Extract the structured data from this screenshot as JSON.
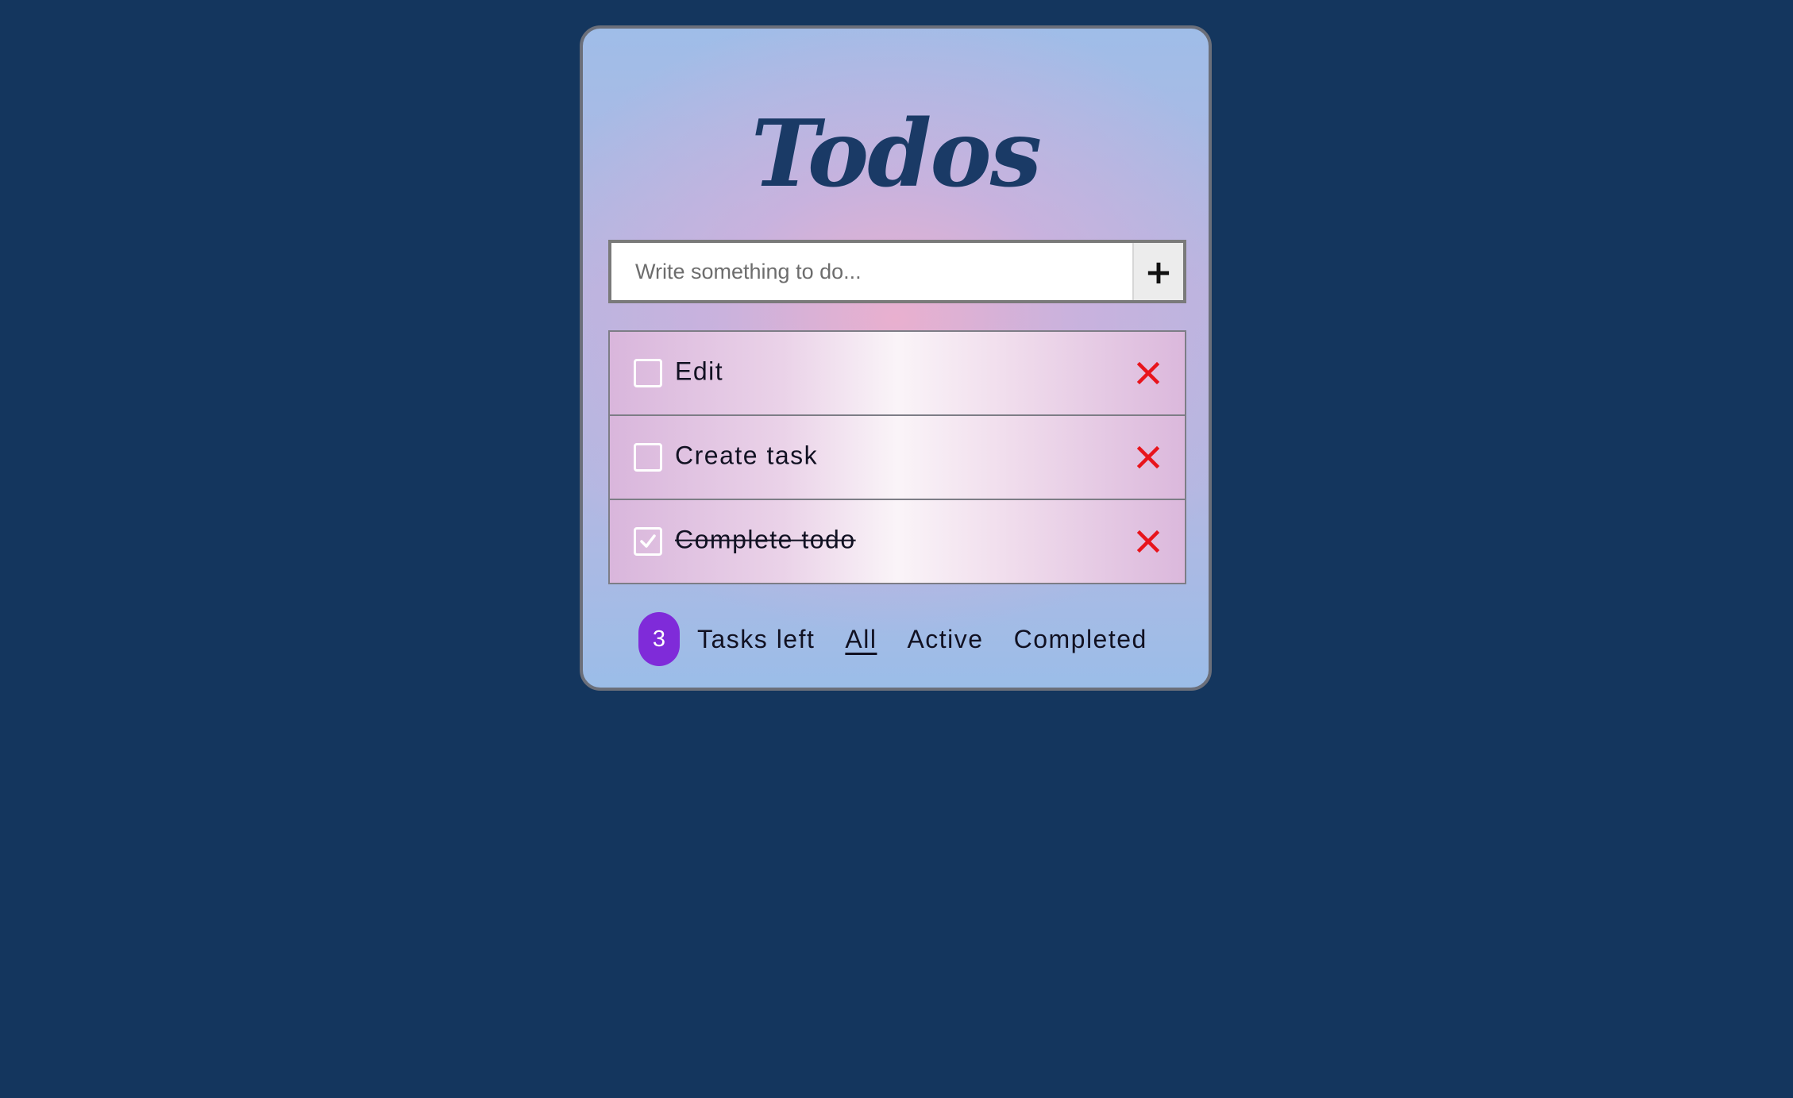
{
  "app": {
    "title": "Todos"
  },
  "add_form": {
    "placeholder": "Write something to do...",
    "add_button_label": "+"
  },
  "todos": [
    {
      "label": "Edit",
      "completed": false
    },
    {
      "label": "Create task",
      "completed": false
    },
    {
      "label": "Complete todo",
      "completed": true
    }
  ],
  "footer": {
    "count": "3",
    "tasks_left_label": "Tasks left",
    "filters": [
      {
        "label": "All",
        "active": true
      },
      {
        "label": "Active",
        "active": false
      },
      {
        "label": "Completed",
        "active": false
      }
    ]
  },
  "colors": {
    "page_background": "#14365e",
    "title": "#1a3a66",
    "badge": "#7f2bd9",
    "delete_icon": "#e8141c"
  },
  "icons": {
    "add": "plus-icon",
    "delete": "close-icon",
    "checked": "checkmark-icon"
  }
}
